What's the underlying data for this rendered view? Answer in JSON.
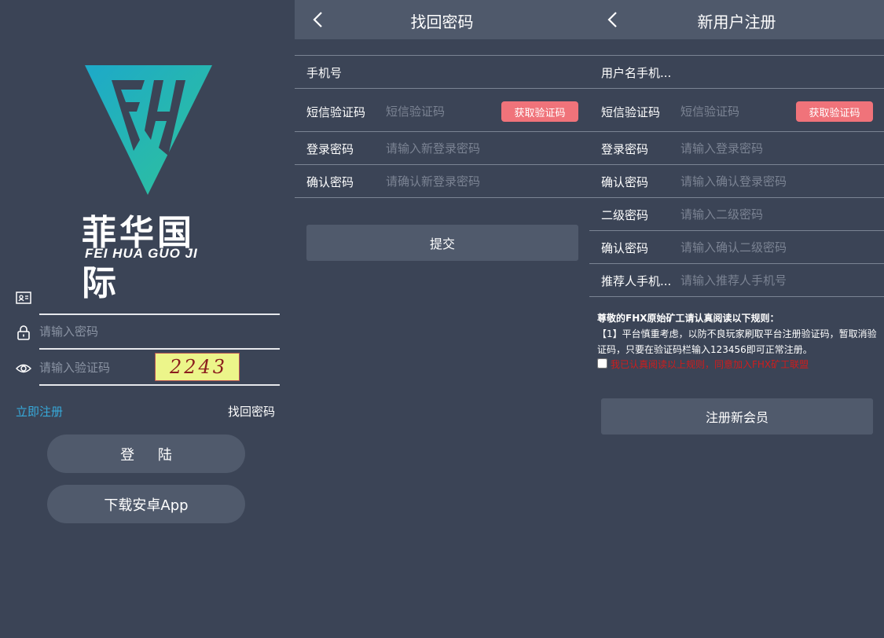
{
  "login": {
    "logo_text_cn": "菲华国际",
    "logo_text_en": "FEI HUA GUO JI",
    "username_placeholder": "",
    "password_placeholder": "请输入密码",
    "captcha_placeholder": "请输入验证码",
    "captcha_text": "2243",
    "register_link": "立即注册",
    "forgot_link": "找回密码",
    "login_button": "登 陆",
    "download_button": "下载安卓App"
  },
  "forgot": {
    "title": "找回密码",
    "phone_label": "手机号",
    "phone_placeholder": "",
    "sms_label": "短信验证码",
    "sms_placeholder": "短信验证码",
    "get_code_button": "获取验证码",
    "password_label": "登录密码",
    "password_placeholder": "请输入新登录密码",
    "confirm_label": "确认密码",
    "confirm_placeholder": "请确认新登录密码",
    "submit_button": "提交"
  },
  "register": {
    "title": "新用户注册",
    "username_label": "用户名手机...",
    "username_placeholder": "",
    "sms_label": "短信验证码",
    "sms_placeholder": "短信验证码",
    "get_code_button": "获取验证码",
    "password_label": "登录密码",
    "password_placeholder": "请输入登录密码",
    "confirm_label": "确认密码",
    "confirm_placeholder": "请输入确认登录密码",
    "secondary_label": "二级密码",
    "secondary_placeholder": "请输入二级密码",
    "confirm_secondary_label": "确认密码",
    "confirm_secondary_placeholder": "请输入确认二级密码",
    "referrer_label": "推荐人手机...",
    "referrer_placeholder": "请输入推荐人手机号",
    "notice_title": "尊敬的FHX原始矿工请认真阅读以下规则：",
    "notice_body": "【1】平台慎重考虑，以防不良玩家刷取平台注册验证码，暂取消验证码，只要在验证码栏输入123456即可正常注册。",
    "agree_text": "我已认真阅读以上规则，同意加入FHX矿工联盟",
    "submit_button": "注册新会员"
  },
  "colors": {
    "background": "#3b4456",
    "header": "#4f596b",
    "button": "#505a6c",
    "accent_link": "#37a9d9",
    "sms_button": "#f0737a",
    "agree_text": "#d01c1c"
  },
  "icons": [
    "id-card-icon",
    "lock-icon",
    "eye-icon",
    "back-chevron-icon"
  ]
}
